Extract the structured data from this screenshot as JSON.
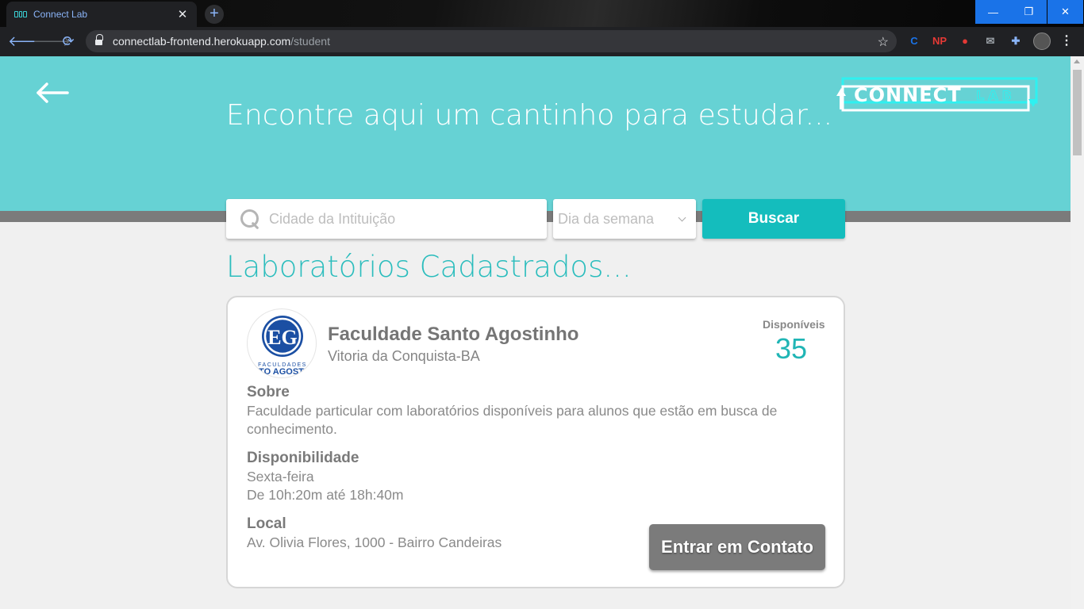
{
  "browser": {
    "tab_title": "Connect Lab",
    "tab_close": "✕",
    "new_tab": "+",
    "url_host": "connectlab-frontend.herokuapp.com",
    "url_path": "/student",
    "window_minimize": "—",
    "window_restore": "❐",
    "window_close": "✕",
    "extensions": [
      {
        "name": "refresh-c-extension-icon",
        "glyph": "C",
        "color": "#1a73e8"
      },
      {
        "name": "np-extension-icon",
        "glyph": "NP",
        "color": "#e53935"
      },
      {
        "name": "stop-extension-icon",
        "glyph": "●",
        "color": "#e53935"
      },
      {
        "name": "mail-extension-icon",
        "glyph": "✉",
        "color": "#9aa0a6"
      },
      {
        "name": "puzzle-extension-icon",
        "glyph": "✚",
        "color": "#8ab4f8"
      }
    ]
  },
  "header": {
    "title": "Encontre aqui um cantinho para estudar...",
    "logo_text_main": "CONNECT",
    "logo_text_sub": "LAB"
  },
  "search": {
    "placeholder": "Cidade da Intituição",
    "day_select_value": "Dia da semana",
    "button_label": "Buscar"
  },
  "section_title": "Laboratórios Cadastrados...",
  "labs": [
    {
      "name": "Faculdade Santo Agostinho",
      "city": "Vitoria da Conquista-BA",
      "logo_text_top": "FACULDADES",
      "logo_text_bottom": "NTO AGOSTIN",
      "available_label": "Disponíveis",
      "available_count": "35",
      "about_heading": "Sobre",
      "about_text": "Faculdade particular com laboratórios disponíveis para alunos que estão em busca de conhecimento.",
      "availability_heading": "Disponibilidade",
      "availability_day": "Sexta-feira",
      "availability_time": "De 10h:20m até 18h:40m",
      "location_heading": "Local",
      "location_text": "Av. Olivia Flores, 1000 - Bairro Candeiras",
      "contact_button": "Entrar em Contato"
    }
  ],
  "colors": {
    "hero": "#66d2d4",
    "accent": "#14bdbd",
    "band": "#7b7b7b"
  }
}
